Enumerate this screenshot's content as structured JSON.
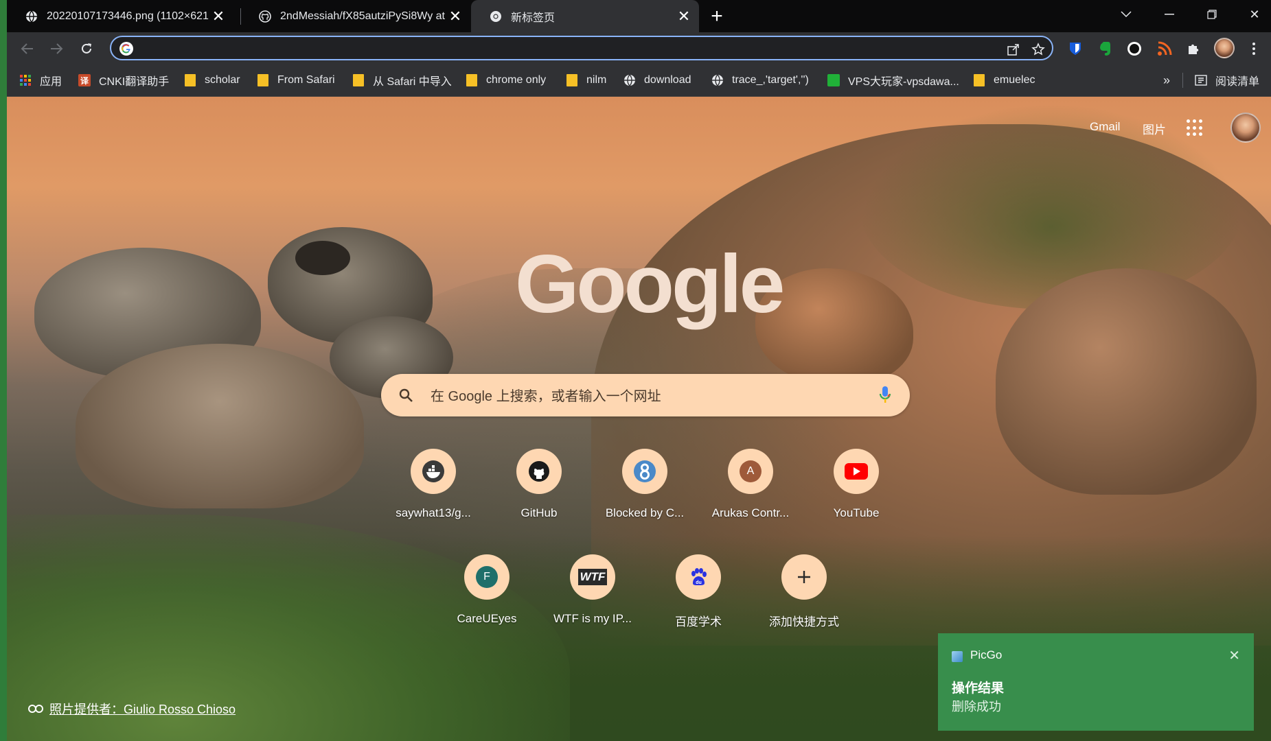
{
  "tabs": [
    {
      "title": "20220107173446.png (1102×621",
      "icon": "globe-icon",
      "active": false
    },
    {
      "title": "2ndMessiah/fX85autziPySi8Wy at",
      "icon": "github-icon",
      "active": false
    },
    {
      "title": "新标签页",
      "icon": "chrome-icon",
      "active": true
    }
  ],
  "toolbar": {
    "address_value": "",
    "extensions": [
      "bitwarden-icon",
      "evernote-icon",
      "circle-extension-icon",
      "rss-icon",
      "puzzle-icon",
      "profile-avatar",
      "more-menu-icon"
    ]
  },
  "bookmarks": {
    "items": [
      {
        "label": "应用",
        "icon": "apps-grid-icon"
      },
      {
        "label": "CNKI翻译助手",
        "icon": "cnki-icon"
      },
      {
        "label": "scholar",
        "icon": "folder-icon"
      },
      {
        "label": "From Safari",
        "icon": "folder-icon"
      },
      {
        "label": "从 Safari 中导入",
        "icon": "folder-icon"
      },
      {
        "label": "chrome only",
        "icon": "folder-icon"
      },
      {
        "label": "nilm",
        "icon": "folder-icon"
      },
      {
        "label": "download",
        "icon": "globe-icon"
      },
      {
        "label": "trace_,'target','')",
        "icon": "globe-icon"
      },
      {
        "label": "VPS大玩家-vpsdawa...",
        "icon": "vps-icon"
      },
      {
        "label": "emuelec",
        "icon": "folder-icon"
      }
    ],
    "overflow": "»",
    "reading_list": "阅读清单"
  },
  "ntp": {
    "gmail": "Gmail",
    "images": "图片",
    "logo": "Google",
    "search_placeholder": "在 Google 上搜索，或者输入一个网址",
    "shortcuts_row1": [
      {
        "label": "saywhat13/g...",
        "icon": "docker-icon"
      },
      {
        "label": "GitHub",
        "icon": "github-icon"
      },
      {
        "label": "Blocked by C...",
        "icon": "blocked-8-icon"
      },
      {
        "label": "Arukas Contr...",
        "icon": "letter-a-icon",
        "letter": "A"
      },
      {
        "label": "YouTube",
        "icon": "youtube-icon"
      }
    ],
    "shortcuts_row2": [
      {
        "label": "CareUEyes",
        "icon": "letter-f-icon",
        "letter": "F"
      },
      {
        "label": "WTF is my IP...",
        "icon": "wtf-icon",
        "letter": "WTF"
      },
      {
        "label": "百度学术",
        "icon": "baidu-paw-icon"
      },
      {
        "label": "添加快捷方式",
        "icon": "plus-icon"
      }
    ],
    "photo_credit": "照片提供者：Giulio Rosso Chioso"
  },
  "toast": {
    "app": "PicGo",
    "title": "操作结果",
    "message": "删除成功"
  },
  "colors": {
    "search_bg": "#fed7b2",
    "toast_bg": "#388e4c",
    "omnibox_border": "#8ab4f8"
  }
}
